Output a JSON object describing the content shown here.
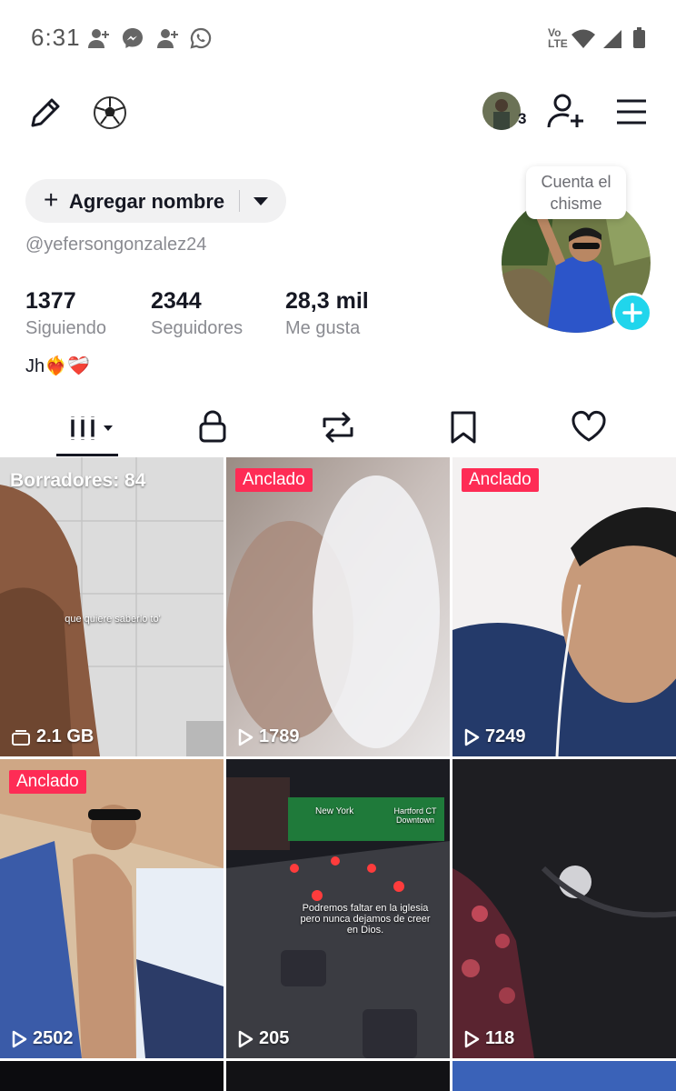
{
  "status_bar": {
    "time": "6:31",
    "left_icons": [
      "person-add-icon",
      "messenger-icon",
      "person-add-icon",
      "whatsapp-icon"
    ],
    "right_icons": [
      "volte-icon",
      "wifi-icon",
      "signal-icon",
      "battery-icon"
    ],
    "volte_label": "Vo\nLTE"
  },
  "topbar": {
    "left_icons": [
      "pencil-icon",
      "soccer-ball-icon"
    ],
    "friends_count": "3",
    "right_icons": [
      "add-friend-icon",
      "menu-icon"
    ]
  },
  "profile": {
    "add_name_label": "Agregar nombre",
    "username": "@yefersongonzalez24",
    "stats": [
      {
        "value": "1377",
        "label": "Siguiendo"
      },
      {
        "value": "2344",
        "label": "Seguidores"
      },
      {
        "value": "28,3 mil",
        "label": "Me gusta"
      }
    ],
    "bio": "Jh",
    "bio_emojis": "❤️‍🔥❤️‍🩹",
    "tooltip": "Cuenta el\nchisme"
  },
  "tabs": [
    {
      "name": "videos",
      "icon": "grid-icon",
      "active": true
    },
    {
      "name": "private",
      "icon": "lock-icon",
      "active": false
    },
    {
      "name": "reposts",
      "icon": "repost-icon",
      "active": false
    },
    {
      "name": "favorites",
      "icon": "bookmark-icon",
      "active": false
    },
    {
      "name": "liked",
      "icon": "heart-icon",
      "active": false
    }
  ],
  "grid": [
    {
      "type": "drafts",
      "label": "Borradores: 84",
      "size": "2.1 GB",
      "overlay": "que quiere saberlo to'"
    },
    {
      "type": "video",
      "badge": "Anclado",
      "views": "1789"
    },
    {
      "type": "video",
      "badge": "Anclado",
      "views": "7249"
    },
    {
      "type": "video",
      "badge": "Anclado",
      "views": "2502"
    },
    {
      "type": "video",
      "badge": "",
      "views": "205",
      "overlay": "Podremos faltar en la iglesia pero nunca dejamos de creer en Dios.",
      "sign_top": "New York",
      "sign_right": "Hartford CT Downtown"
    },
    {
      "type": "video",
      "badge": "",
      "views": "118"
    }
  ],
  "colors": {
    "accent": "#fe2c55",
    "add_button": "#20d5ec",
    "text_primary": "#161823",
    "text_secondary": "#8a8b91"
  }
}
